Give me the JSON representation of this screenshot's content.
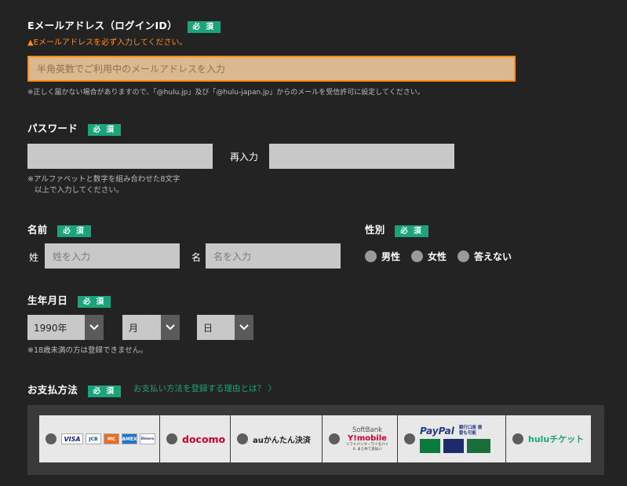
{
  "required_label": "必 須",
  "email": {
    "label": "Eメールアドレス（ログインID）",
    "error": "Eメールアドレスを必ず入力してください。",
    "placeholder": "半角英数でご利用中のメールアドレスを入力",
    "note": "※正しく届かない場合がありますので、「@hulu.jp」及び「@hulu-japan.jp」からのメールを受信許可に設定してください。"
  },
  "password": {
    "label": "パスワード",
    "reenter_label": "再入力",
    "note_line1": "※アルファベットと数字を組み合わせた8文字",
    "note_line2": "以上で入力してください。"
  },
  "name": {
    "label": "名前",
    "last_label": "姓",
    "last_placeholder": "姓を入力",
    "first_label": "名",
    "first_placeholder": "名を入力"
  },
  "gender": {
    "label": "性別",
    "options": [
      "男性",
      "女性",
      "答えない"
    ]
  },
  "birthdate": {
    "label": "生年月日",
    "year": "1990年",
    "month": "月",
    "day": "日",
    "note": "※18歳未満の方は登録できません。"
  },
  "payment": {
    "label": "お支払方法",
    "reason_link": "お支払い方法を登録する理由とは？ 〉",
    "methods": {
      "docomo": "docomo",
      "au": "auかんたん決済",
      "softbank_top": "SoftBank",
      "softbank_mid": "Y!mobile",
      "softbank_bottom": "ソフトバンク・ワイモバイル まとめて支払い",
      "paypal": "PayPal",
      "paypal_note": "銀行口座 振替も可能",
      "hulu": "huluチケット"
    },
    "cards": [
      "VISA",
      "JCB",
      "MC",
      "AMEX",
      "Diners"
    ]
  },
  "colors": {
    "background": "#232323",
    "accent": "#1ba37a",
    "warning": "#ff8c1a"
  }
}
